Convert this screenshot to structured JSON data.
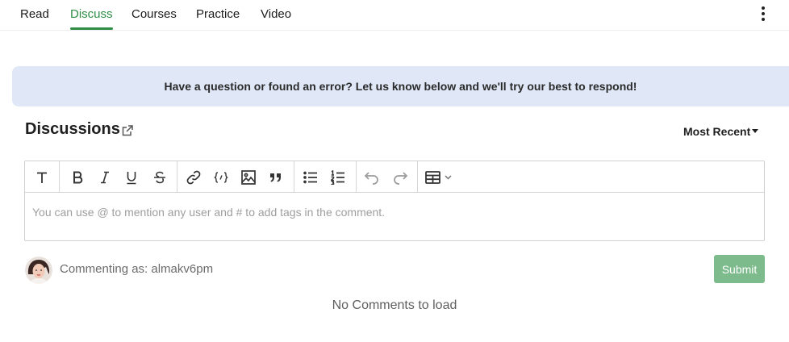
{
  "tabs": [
    {
      "label": "Read"
    },
    {
      "label": "Discuss"
    },
    {
      "label": "Courses"
    },
    {
      "label": "Practice"
    },
    {
      "label": "Video"
    }
  ],
  "active_tab": "Discuss",
  "banner": {
    "text": "Have a question or found an error? Let us know below and we'll try our best to respond!"
  },
  "discussions": {
    "title": "Discussions",
    "sort_label": "Most Recent"
  },
  "editor": {
    "placeholder": "You can use @ to mention any user and # to add tags in the comment.",
    "toolbar": [
      "text-style-icon",
      "bold-icon",
      "italic-icon",
      "underline-icon",
      "strikethrough-icon",
      "link-icon",
      "code-block-icon",
      "image-icon",
      "quote-icon",
      "bullet-list-icon",
      "numbered-list-icon",
      "undo-icon",
      "redo-icon",
      "table-icon"
    ]
  },
  "comment": {
    "commenting_as": "Commenting as: almakv6pm",
    "submit_label": "Submit"
  },
  "empty_state": "No Comments to load",
  "colors": {
    "accent": "#2f8d46",
    "banner_bg": "#e0e8f8",
    "submit_bg": "#7dbb8d"
  }
}
